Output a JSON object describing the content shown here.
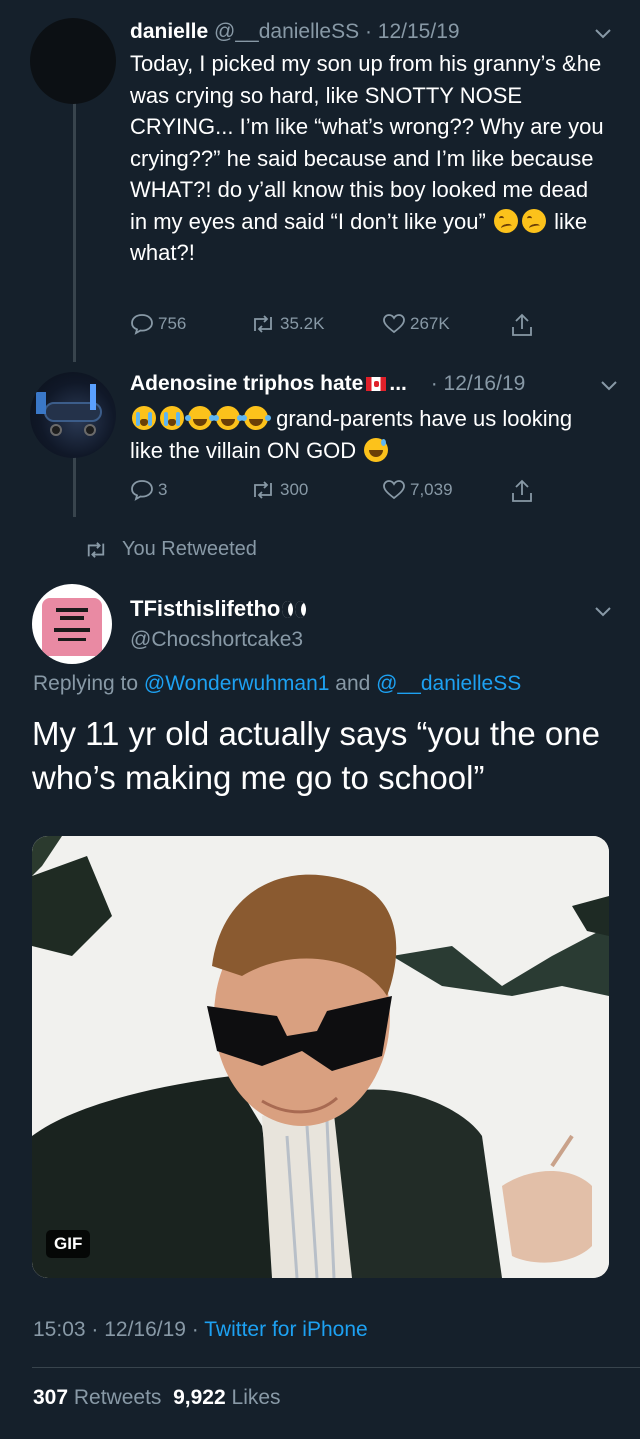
{
  "colors": {
    "background": "#15202b",
    "muted": "#8899a6",
    "accent": "#1da1f2",
    "divider": "#38444d"
  },
  "tweets": [
    {
      "name": "danielle",
      "handle": "@__danielleSS",
      "date": "· 12/15/19",
      "text_1": "Today, I picked my son up from his granny’s &he was crying so hard, like SNOTTY NOSE CRYING... I’m like “what’s wrong?? Why are you crying??” he said because and I’m like because WHAT?! do y’all know this boy looked me dead in my eyes and said “I don’t like you”",
      "emoji": [
        "woozy-face-icon",
        "woozy-face-icon"
      ],
      "text_2": "like what?!",
      "replies": "756",
      "retweets": "35.2K",
      "likes": "267K"
    },
    {
      "name": "Adenosine triphos hate",
      "name_suffix": "...",
      "handle": "",
      "date": "· 12/16/19",
      "emoji_lead": [
        "sob-icon",
        "sob-icon",
        "joy-icon",
        "joy-icon",
        "joy-icon"
      ],
      "text_1": "grand-parents have us looking like the villain ON GOD",
      "emoji_trail": "sweat-smile-icon",
      "replies": "3",
      "retweets": "300",
      "likes": "7,039"
    }
  ],
  "retweet_note": "You Retweeted",
  "main_tweet": {
    "name": "TFisthislifetho",
    "handle": "@Chocshortcake3",
    "replying_prefix": "Replying to",
    "reply_to_1": "@Wonderwuhman1",
    "reply_and": "and",
    "reply_to_2": "@__danielleSS",
    "text": "My 11 yr old actually says “you the one who’s making me go to school”",
    "media_badge": "GIF",
    "time": "15:03 · 12/16/19 ·",
    "source": "Twitter for iPhone",
    "retweet_count": "307",
    "retweet_label": "Retweets",
    "like_count": "9,922",
    "like_label": "Likes"
  }
}
